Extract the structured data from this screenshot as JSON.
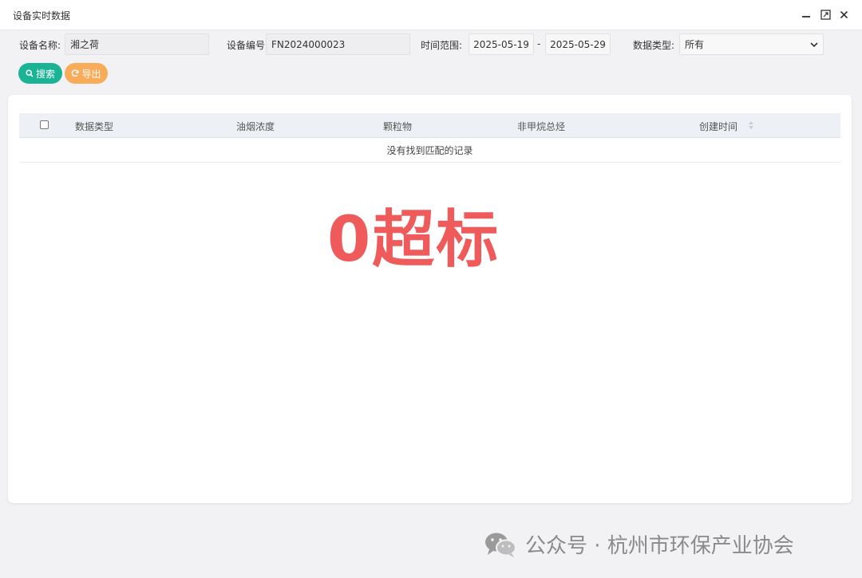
{
  "window": {
    "title": "设备实时数据"
  },
  "filters": {
    "device_name_label": "设备名称:",
    "device_name_value": "湘之荷",
    "device_code_label": "设备编号:",
    "device_code_value": "FN2024000023",
    "time_range_label": "时间范围:",
    "date_start": "2025-05-19",
    "date_sep": "-",
    "date_end": "2025-05-29",
    "data_type_label": "数据类型:",
    "data_type_value": "所有"
  },
  "buttons": {
    "search": "搜索",
    "export": "导出"
  },
  "table": {
    "columns": [
      "数据类型",
      "油烟浓度",
      "颗粒物",
      "非甲烷总烃",
      "创建时间"
    ],
    "empty_text": "没有找到匹配的记录"
  },
  "overlay": {
    "text": "0超标",
    "color": "#ef5b5b"
  },
  "watermark": {
    "text": "公众号 · 杭州市环保产业协会"
  },
  "colors": {
    "search_button": "#1ab394",
    "export_button": "#f8ac59"
  }
}
